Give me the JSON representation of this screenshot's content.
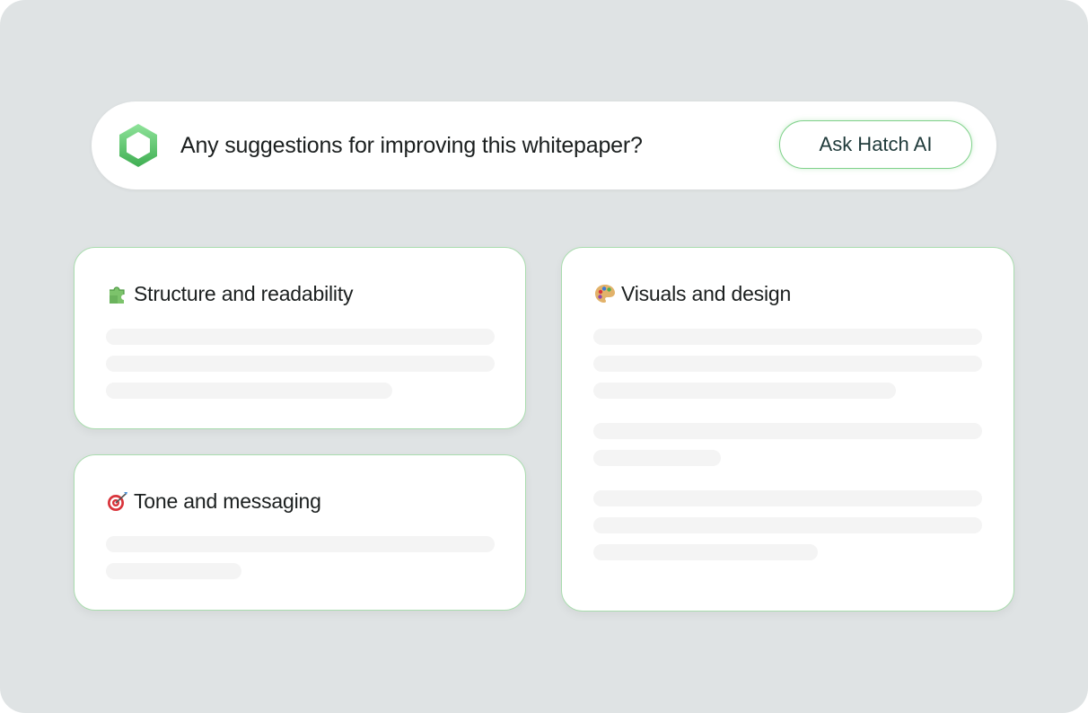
{
  "prompt": {
    "question": "Any suggestions for improving this whitepaper?",
    "button_label": "Ask Hatch AI",
    "logo_icon": "hatch-hexagon-logo",
    "accent_color": "#5cc96a"
  },
  "cards": [
    {
      "title": "Structure and readability",
      "icon": "puzzle-piece-icon"
    },
    {
      "title": "Tone and messaging",
      "icon": "target-icon"
    },
    {
      "title": "Visuals and design",
      "icon": "palette-icon"
    }
  ],
  "colors": {
    "background": "#dfe3e4",
    "card": "#ffffff",
    "card_border": "#a9dcae",
    "placeholder_line": "#f4f4f4",
    "text": "#1b1f1f"
  }
}
